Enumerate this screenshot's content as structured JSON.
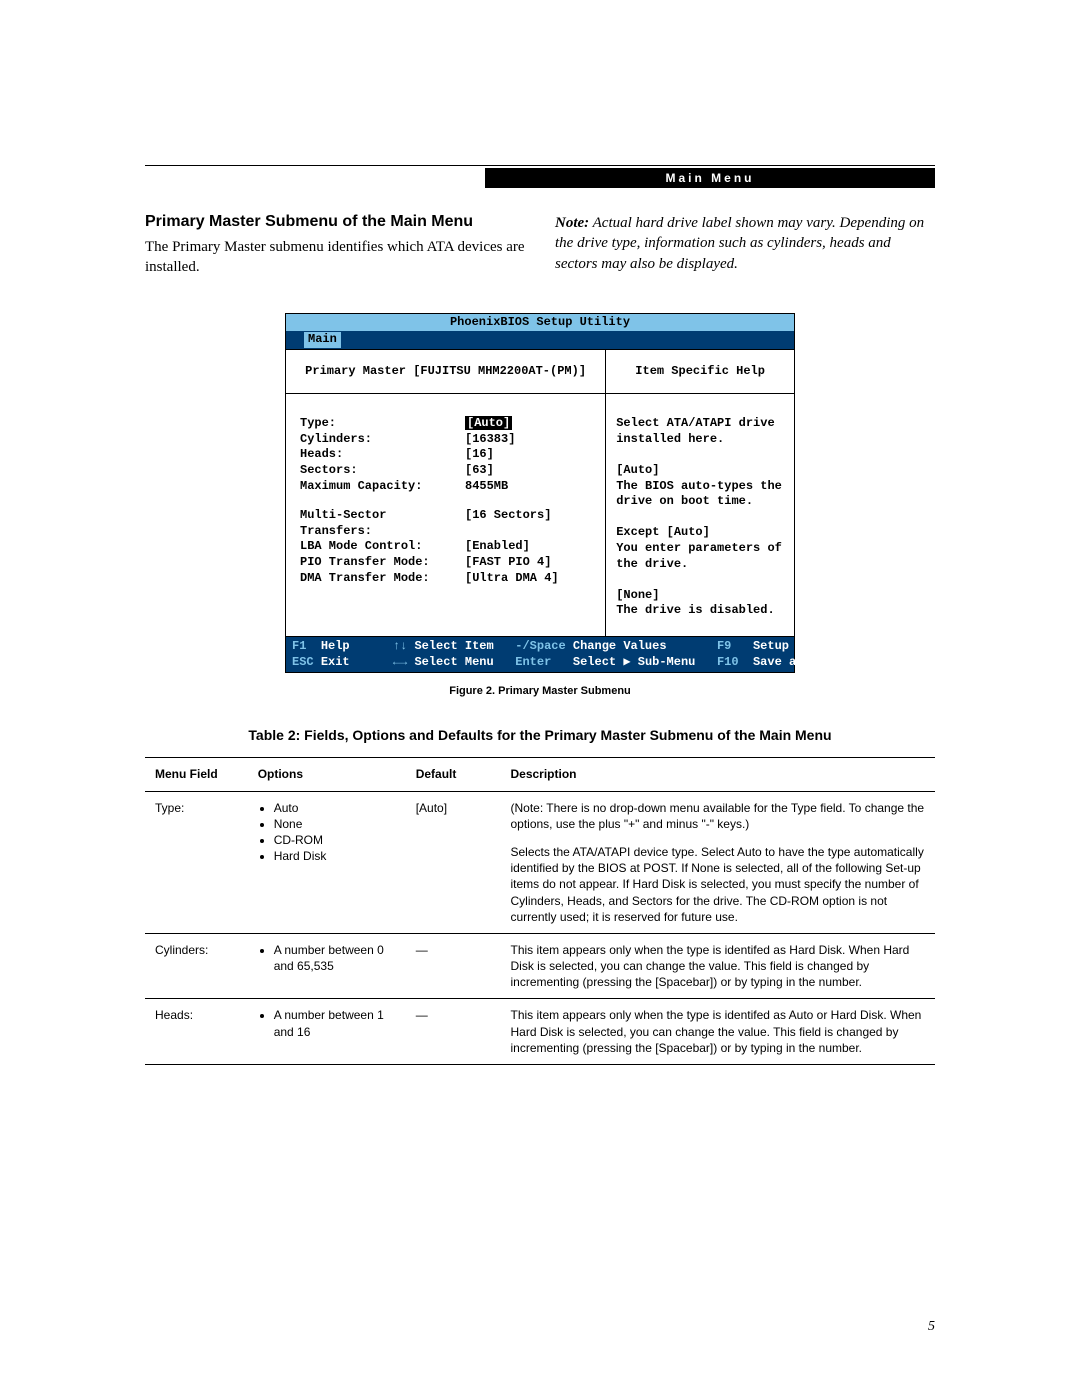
{
  "header_label": "Main Menu",
  "section_title": "Primary Master Submenu of the Main Menu",
  "intro_text": "The Primary Master submenu identifies which ATA devices are installed.",
  "note_label": "Note:",
  "note_text": " Actual hard drive label shown may vary.  Depending on the drive type, information such as cylinders, heads and sectors may also be displayed.",
  "bios": {
    "title": "PhoenixBIOS Setup Utility",
    "tab_active": "Main",
    "left_head": "Primary Master [FUJITSU MHM2200AT-(PM)]",
    "fields": [
      {
        "label": "Type:",
        "value": "[Auto]",
        "highlight": true
      },
      {
        "label": "Cylinders:",
        "value": "[16383]"
      },
      {
        "label": "Heads:",
        "value": "[16]"
      },
      {
        "label": "Sectors:",
        "value": "[63]"
      },
      {
        "label": "Maximum Capacity:",
        "value": "8455MB"
      }
    ],
    "fields2": [
      {
        "label": "Multi-Sector Transfers:",
        "value": "[16 Sectors]"
      },
      {
        "label": "LBA Mode Control:",
        "value": "[Enabled]"
      },
      {
        "label": "PIO Transfer Mode:",
        "value": "[FAST PIO 4]"
      },
      {
        "label": "DMA Transfer Mode:",
        "value": "[Ultra DMA 4]"
      }
    ],
    "right_head": "Item Specific Help",
    "help_lines": [
      "Select ATA/ATAPI drive",
      "installed here.",
      "",
      "[Auto]",
      "The BIOS auto-types the",
      "drive on boot time.",
      "",
      "Except [Auto]",
      "You enter parameters of",
      "the drive.",
      "",
      "[None]",
      "The drive is disabled."
    ],
    "footer": {
      "f1": "F1",
      "help": "Help",
      "updown": "↑↓",
      "select_item": "Select Item",
      "minus_space": "-/Space",
      "change_values": "Change Values",
      "f9": "F9",
      "setup_defaults": "Setup Defaults",
      "esc": "ESC",
      "exit": "Exit",
      "lr": "←→",
      "select_menu": "Select Menu",
      "enter": "Enter",
      "select_sub": "Select ▶ Sub-Menu",
      "f10": "F10",
      "save_exit": "Save and Exit"
    }
  },
  "figure_caption": "Figure 2.  Primary Master Submenu",
  "table_title": "Table 2: Fields, Options and Defaults for the Primary Master Submenu of the Main Menu",
  "table": {
    "headers": [
      "Menu Field",
      "Options",
      "Default",
      "Description"
    ],
    "rows": [
      {
        "field": "Type:",
        "options": [
          "Auto",
          "None",
          "CD-ROM",
          "Hard Disk"
        ],
        "default": "[Auto]",
        "desc": "(Note: There is no drop-down menu available for the Type field. To change the options, use the plus \"+\" and minus \"-\" keys.)\n\nSelects the ATA/ATAPI device type. Select Auto to have the type automatically identified by the BIOS at POST. If None is selected, all of the following Set-up items do not appear. If Hard Disk is selected, you must specify the number of Cylinders, Heads, and Sectors for the drive. The CD-ROM option is not currently used; it is reserved for future use."
      },
      {
        "field": "Cylinders:",
        "options": [
          "A number between 0 and 65,535"
        ],
        "default": "—",
        "desc": "This item appears only when the type is identifed as Hard Disk. When Hard Disk is selected, you can change the value. This field is changed by incrementing (pressing the [Spacebar]) or by typing in the number."
      },
      {
        "field": "Heads:",
        "options": [
          "A number between 1 and 16"
        ],
        "default": "—",
        "desc": "This item appears only when the type is identifed as Auto or Hard Disk. When Hard Disk is selected, you can change the value. This field is changed by incrementing (pressing the [Spacebar]) or by typing in the number."
      }
    ]
  },
  "page_number": "5"
}
